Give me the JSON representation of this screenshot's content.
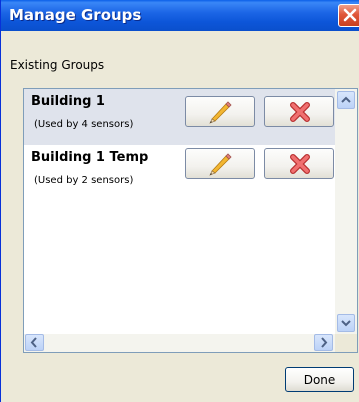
{
  "window": {
    "title": "Manage Groups"
  },
  "section": {
    "label": "Existing Groups"
  },
  "groups": [
    {
      "name": "Building 1",
      "usage": "(Used by 4 sensors)",
      "selected": true
    },
    {
      "name": "Building 1 Temp",
      "usage": "(Used by 2 sensors)",
      "selected": false
    }
  ],
  "icons": {
    "edit": "pencil-icon",
    "delete": "red-x-icon",
    "close": "close-icon"
  },
  "footer": {
    "done_label": "Done"
  },
  "colors": {
    "title_bar": "#0d56d9",
    "selected_row": "#dfe3ec",
    "delete_icon": "#e05050"
  }
}
